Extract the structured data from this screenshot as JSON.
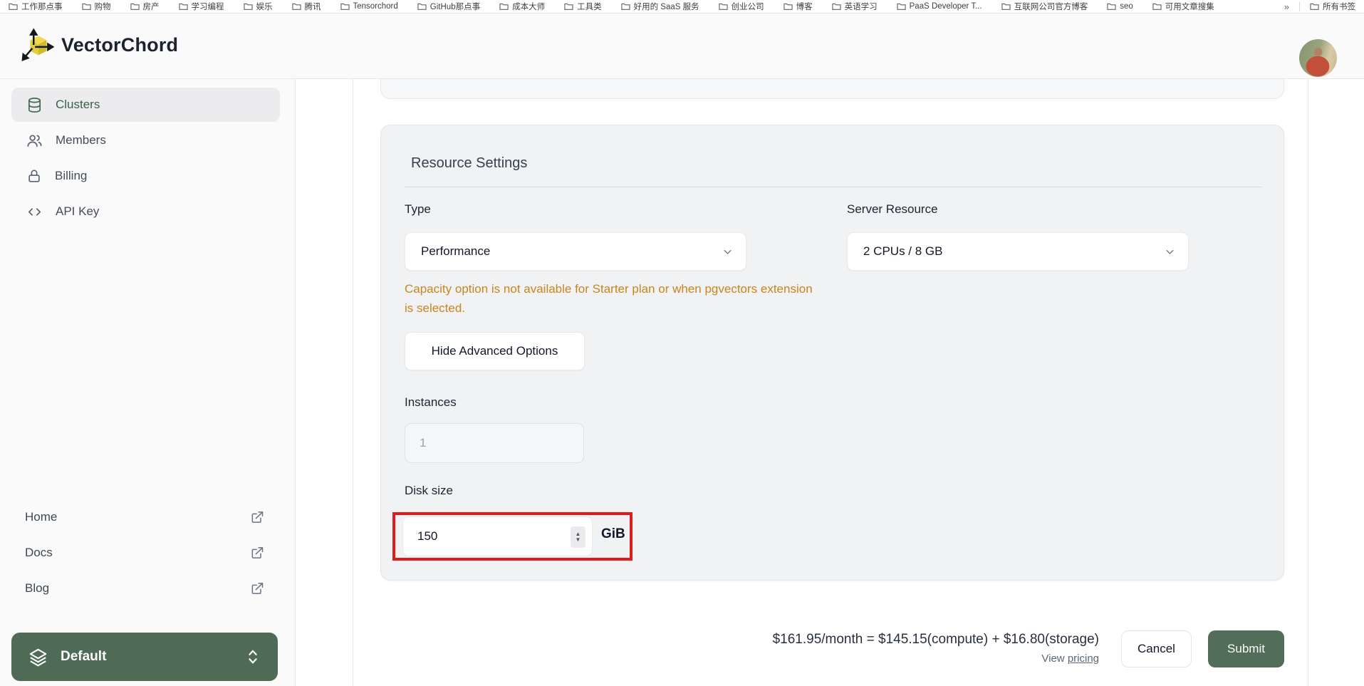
{
  "bookmarks_bar": {
    "items": [
      "工作那点事",
      "购物",
      "房产",
      "学习编程",
      "娱乐",
      "腾讯",
      "Tensorchord",
      "GitHub那点事",
      "成本大师",
      "工具类",
      "好用的 SaaS 服务",
      "创业公司",
      "博客",
      "英语学习",
      "PaaS Developer T...",
      "互联网公司官方博客",
      "seo",
      "可用文章搜集"
    ],
    "overflow_chevron": "»",
    "all_bookmarks_label": "所有书签"
  },
  "header": {
    "app_name": "VectorChord"
  },
  "sidebar": {
    "nav": [
      {
        "label": "Clusters",
        "icon": "database-icon",
        "active": true
      },
      {
        "label": "Members",
        "icon": "users-icon",
        "active": false
      },
      {
        "label": "Billing",
        "icon": "lock-icon",
        "active": false
      },
      {
        "label": "API Key",
        "icon": "code-icon",
        "active": false
      }
    ],
    "links": [
      {
        "label": "Home",
        "icon": "external-link-icon"
      },
      {
        "label": "Docs",
        "icon": "external-link-icon"
      },
      {
        "label": "Blog",
        "icon": "external-link-icon"
      }
    ],
    "project_switcher": {
      "label": "Default",
      "icon": "layers-icon"
    }
  },
  "form": {
    "title": "Resource Settings",
    "type": {
      "label": "Type",
      "value": "Performance"
    },
    "server_resource": {
      "label": "Server Resource",
      "value": "2 CPUs / 8 GB"
    },
    "warning": "Capacity option is not available for Starter plan or when pgvectors extension is selected.",
    "advanced_button_label": "Hide Advanced Options",
    "instances": {
      "label": "Instances",
      "value": "1"
    },
    "disk_size": {
      "label": "Disk size",
      "value": "150",
      "unit": "GiB"
    }
  },
  "footer": {
    "price_summary": "$161.95/month = $145.15(compute) + $16.80(storage)",
    "view_pricing_prefix": "View ",
    "view_pricing_link": "pricing",
    "cancel_label": "Cancel",
    "submit_label": "Submit"
  },
  "colors": {
    "brand_green": "#4f6b55",
    "active_nav_green": "#38614a",
    "logo_yellow": "#e8d44d",
    "warning_orange": "#c9851c",
    "annotation_red": "#de1c1c",
    "card_bg": "#f1f2f4",
    "sidebar_bg": "#fafafa"
  }
}
